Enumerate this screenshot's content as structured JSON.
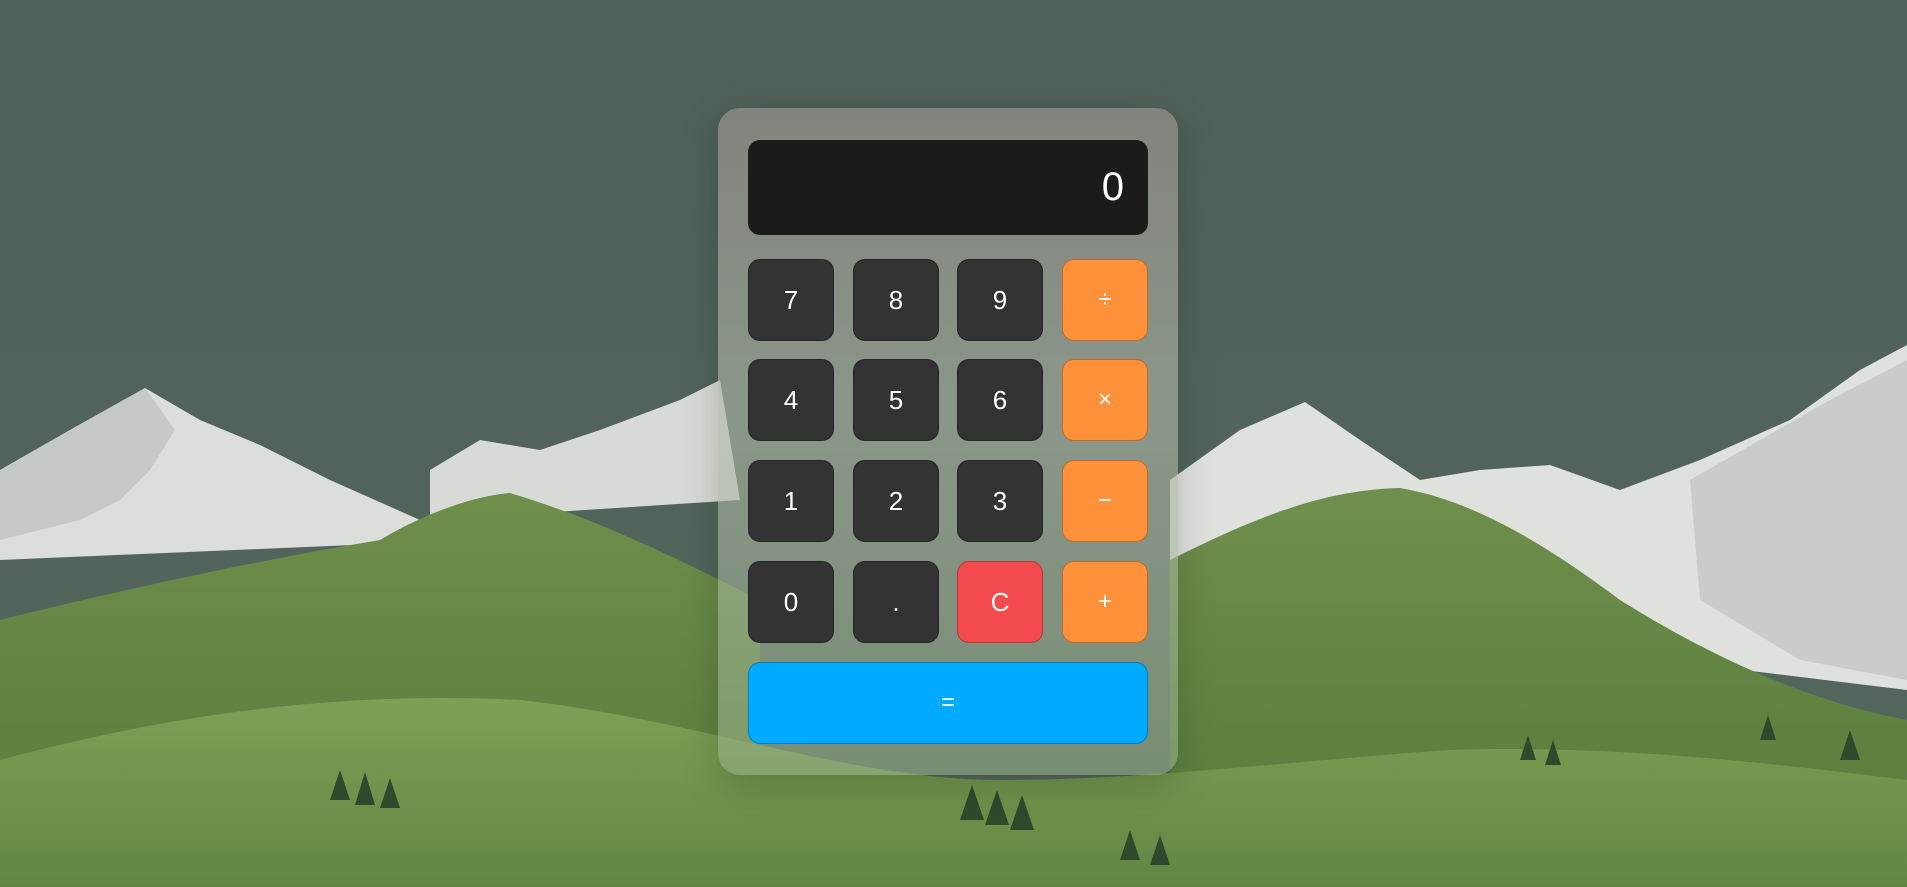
{
  "calculator": {
    "display_value": "0",
    "keys": {
      "seven": "7",
      "eight": "8",
      "nine": "9",
      "divide": "÷",
      "four": "4",
      "five": "5",
      "six": "6",
      "multiply": "×",
      "one": "1",
      "two": "2",
      "three": "3",
      "subtract": "−",
      "zero": "0",
      "decimal": ".",
      "clear": "C",
      "add": "+",
      "equals": "="
    }
  },
  "colors": {
    "number_key": "#333333",
    "operator_key": "#ff913a",
    "clear_key": "#f24a4e",
    "equals_key": "#00aaff",
    "display": "#1b1c1a"
  }
}
